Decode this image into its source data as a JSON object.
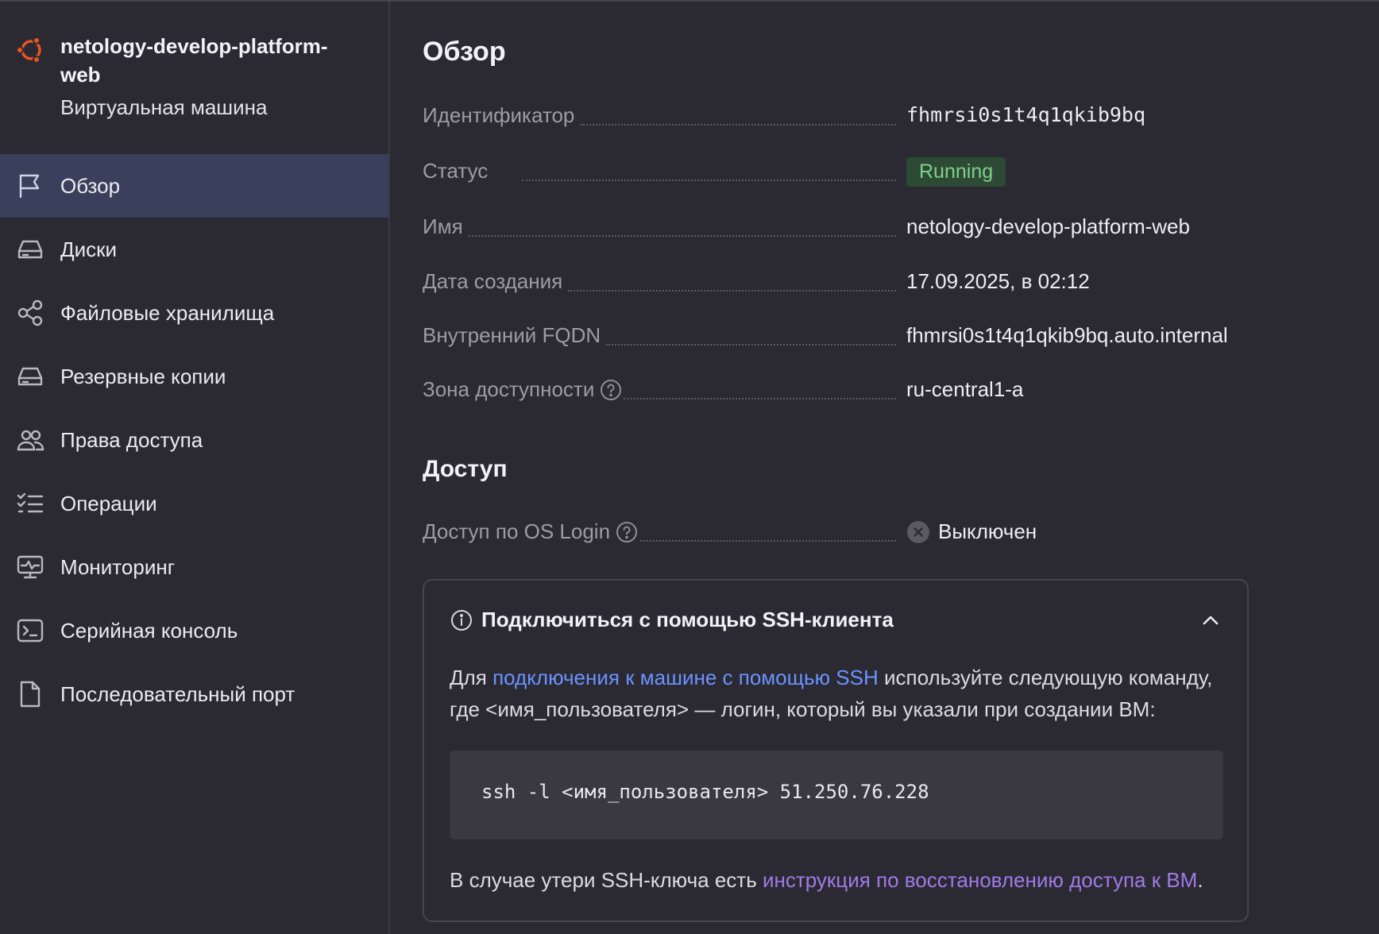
{
  "vm": {
    "title": "netology-develop-platform-web",
    "subtitle": "Виртуальная машина"
  },
  "sidebar": {
    "items": [
      {
        "label": "Обзор",
        "icon": "flag-icon",
        "active": true
      },
      {
        "label": "Диски",
        "icon": "disk-icon"
      },
      {
        "label": "Файловые хранилища",
        "icon": "share-icon"
      },
      {
        "label": "Резервные копии",
        "icon": "backup-icon"
      },
      {
        "label": "Права доступа",
        "icon": "users-icon"
      },
      {
        "label": "Операции",
        "icon": "checklist-icon"
      },
      {
        "label": "Мониторинг",
        "icon": "monitor-icon"
      },
      {
        "label": "Серийная консоль",
        "icon": "terminal-icon"
      },
      {
        "label": "Последовательный порт",
        "icon": "file-icon"
      }
    ]
  },
  "overview": {
    "title": "Обзор",
    "rows": [
      {
        "label": "Идентификатор",
        "value": "fhmrsi0s1t4q1qkib9bq"
      },
      {
        "label": "Статус",
        "value": "Running"
      },
      {
        "label": "Имя",
        "value": "netology-develop-platform-web"
      },
      {
        "label": "Дата создания",
        "value": "17.09.2025, в 02:12"
      },
      {
        "label": "Внутренний FQDN",
        "value": "fhmrsi0s1t4q1qkib9bq.auto.internal"
      },
      {
        "label": "Зона доступности",
        "value": "ru-central1-a"
      }
    ]
  },
  "access": {
    "title": "Доступ",
    "os_login_label": "Доступ по OS Login",
    "os_login_value": "Выключен"
  },
  "ssh": {
    "title": "Подключиться с помощью SSH-клиента",
    "text_before": "Для ",
    "link": "подключения к машине с помощью SSH",
    "text_after": " используйте следующую команду, где <имя_пользователя> — логин, который вы указали при создании ВМ:",
    "command": "ssh -l <имя_пользователя> 51.250.76.228",
    "foot_before": "В случае утери SSH-ключа есть ",
    "foot_link": "инструкция по восстановлению доступа к ВМ",
    "foot_after": "."
  },
  "colors": {
    "background": "#2b2a33",
    "active_nav": "#3a405b",
    "running_badge_bg": "#2d4a35",
    "running_badge_text": "#7fd18b",
    "link_blue": "#6b93ff",
    "link_purple": "#a07ae6",
    "ubuntu_orange": "#e95420"
  }
}
